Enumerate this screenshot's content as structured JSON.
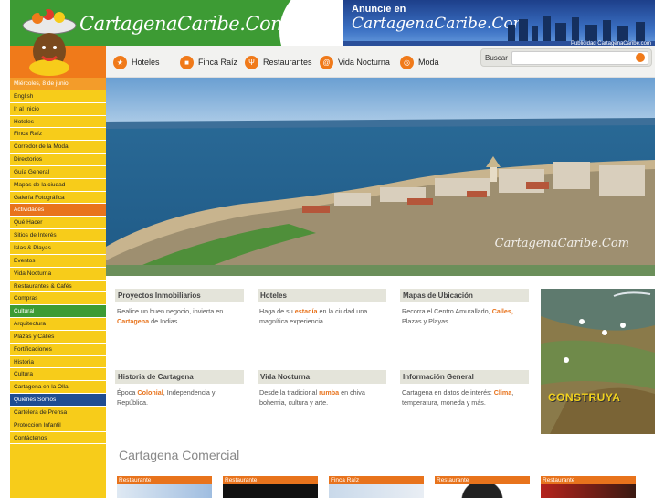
{
  "header": {
    "logo_text": "CartagenaCaribe.Com",
    "ad_line1": "Anuncie en",
    "ad_line2": "CartagenaCaribe.Com",
    "ad_footer": "Publicidad CartagenaCaribe.com"
  },
  "nav": {
    "items": [
      {
        "label": "Hoteles",
        "icon": "star-icon"
      },
      {
        "label": "Finca Raíz",
        "icon": "square-icon"
      },
      {
        "label": "Restaurantes",
        "icon": "fork-icon"
      },
      {
        "label": "Vida Nocturna",
        "icon": "spiral-icon"
      },
      {
        "label": "Moda",
        "icon": "swirl-icon"
      }
    ],
    "search_label": "Buscar",
    "search_value": ""
  },
  "sidebar": {
    "date": "Miércoles, 8 de junio",
    "items": [
      {
        "label": "English",
        "type": "link"
      },
      {
        "label": "Ir al Inicio",
        "type": "link"
      },
      {
        "label": "Hoteles",
        "type": "link"
      },
      {
        "label": "Finca Raíz",
        "type": "link"
      },
      {
        "label": "Corredor de la Moda",
        "type": "link"
      },
      {
        "label": "Directorios",
        "type": "link"
      },
      {
        "label": "Guía General",
        "type": "link"
      },
      {
        "label": "Mapas de la ciudad",
        "type": "link"
      },
      {
        "label": "Galería Fotográfica",
        "type": "link"
      },
      {
        "label": "Actividades",
        "type": "hd-o"
      },
      {
        "label": "Qué Hacer",
        "type": "link"
      },
      {
        "label": "Sitios de Interés",
        "type": "link"
      },
      {
        "label": "Islas & Playas",
        "type": "link"
      },
      {
        "label": "Eventos",
        "type": "link"
      },
      {
        "label": "Vida Nocturna",
        "type": "link"
      },
      {
        "label": "Restaurantes & Cafés",
        "type": "link"
      },
      {
        "label": "Compras",
        "type": "link"
      },
      {
        "label": "Cultural",
        "type": "hd-g"
      },
      {
        "label": "Arquitectura",
        "type": "link"
      },
      {
        "label": "Plazas y Calles",
        "type": "link"
      },
      {
        "label": "Fortificaciones",
        "type": "link"
      },
      {
        "label": "Historia",
        "type": "link"
      },
      {
        "label": "Cultura",
        "type": "link"
      },
      {
        "label": "Cartagena en la Olla",
        "type": "link"
      },
      {
        "label": "Quiénes Somos",
        "type": "hd-b"
      },
      {
        "label": "Cartelera de Prensa",
        "type": "link"
      },
      {
        "label": "Protección Infantil",
        "type": "link"
      },
      {
        "label": "Contáctenos",
        "type": "link"
      }
    ]
  },
  "hero": {
    "watermark": "CartagenaCaribe.Com"
  },
  "boxes": [
    {
      "title": "Proyectos Inmobiliarios",
      "pre": "Realice un buen negocio, invierta en ",
      "hl": "Cartagena",
      "post": " de Indias."
    },
    {
      "title": "Hoteles",
      "pre": "Haga de su ",
      "hl": "estadía",
      "post": " en la ciudad una magnífica experiencia."
    },
    {
      "title": "Mapas de Ubicación",
      "pre": "Recorra el Centro Amurallado, ",
      "hl": "Calles,",
      "post": " Plazas y Playas."
    },
    {
      "title": "Historia de Cartagena",
      "pre": "Época ",
      "hl": "Colonial",
      "post": ", Independencia y República."
    },
    {
      "title": "Vida Nocturna",
      "pre": "Desde la tradicional ",
      "hl": "rumba",
      "post": " en chiva bohemia, cultura y arte."
    },
    {
      "title": "Información General",
      "pre": "Cartagena en datos de interés: ",
      "hl": "Clima",
      "post": ", temperatura, moneda y más."
    }
  ],
  "construya": "CONSTRUYA",
  "comercial_title": "Cartagena Comercial",
  "tiles": [
    "Restaurante",
    "Restaurante",
    "Finca Raíz",
    "Restaurante",
    "Restaurante"
  ]
}
